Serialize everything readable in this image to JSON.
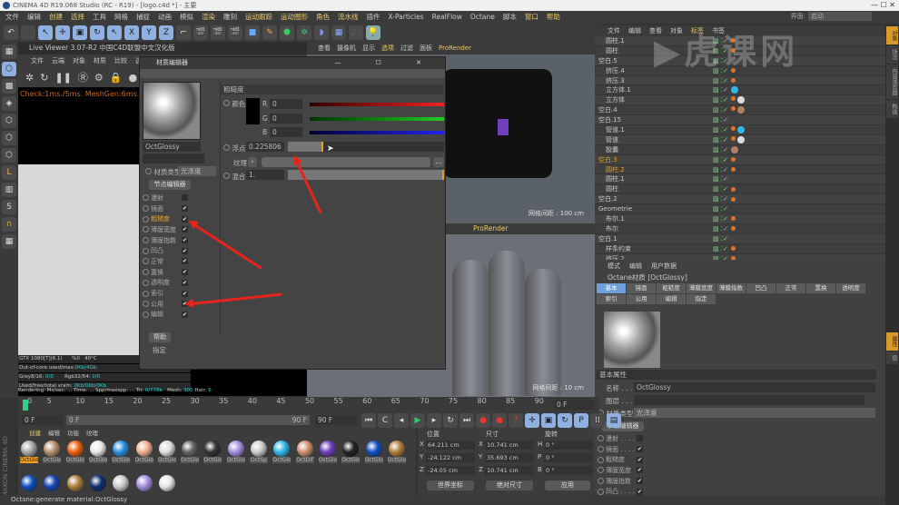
{
  "window": {
    "title": "CINEMA 4D R19.068 Studio (RC - R19) - [logo.c4d *] - 主要",
    "controls": "— ☐ ✕"
  },
  "menubar": {
    "items": [
      "文件",
      "编辑",
      "创建",
      "选择",
      "工具",
      "网格",
      "捕捉",
      "动画",
      "模拟",
      "渲染",
      "雕刻",
      "运动跟踪",
      "运动图形",
      "角色",
      "流水线",
      "插件",
      "X-Particles",
      "RealFlow",
      "Octane",
      "脚本",
      "窗口",
      "帮助"
    ],
    "layout_label": "界面:",
    "layout_value": "启动"
  },
  "live_viewer": {
    "title": "Live Viewer 3.07-R2 中国C4D联盟中文汉化版",
    "menu": [
      "文件",
      "云端",
      "对象",
      "材质",
      "比较",
      "选项"
    ],
    "status": "Check:1ms./5ms. MeshGen:6ms. Update",
    "stats": {
      "gpu": "GTX 1080[T](6.1)",
      "gpu_pct": "%0",
      "gpu_temp": "40°C",
      "ooc_label": "Out-of-core used/max:",
      "ooc_val": "0Kb/4Gb",
      "grey_label": "Grey8/16:",
      "grey_val": "0/0",
      "rgb_label": "Rgb32/64:",
      "rgb_val": "0/0",
      "vram_label": "Used/free/total vram:",
      "vram_val": "0Kb/0Kb/0Kb",
      "rendering": "Rendering:   Ms/sec: ...  Time: ...   Spp/maxspp: ...  Tri:",
      "tri": "0/778k",
      "mesh_label": "Mesh:",
      "mesh": "300",
      "hair_label": "Hair:",
      "hair": "6"
    }
  },
  "viewport_top": {
    "menu": [
      "查看",
      "摄像机",
      "显示",
      "选项",
      "过滤",
      "面板",
      "ProRender"
    ],
    "grid": "网格间距 : 100 cm"
  },
  "viewport_bottom": {
    "title": "ProRender",
    "grid": "网格间距 : 10 cm"
  },
  "material_editor": {
    "title": "材质编辑器",
    "name": "OctGlossy",
    "section": "粗糙度",
    "color_label": "颜色",
    "r": "0",
    "g": "0",
    "b": "0",
    "float_label": "浮点",
    "float_value": "0.225806",
    "float_fraction": 0.225806,
    "texture_label": "纹理",
    "mix_label": "混合",
    "mix_value": "1.",
    "type_label": "材质类型",
    "type_value": "光泽度",
    "node_editor": "节点编辑器",
    "channels": [
      {
        "label": "漫射",
        "on": false
      },
      {
        "label": "镜面",
        "on": true
      },
      {
        "label": "粗糙度",
        "on": true,
        "active": true
      },
      {
        "label": "薄膜宽度",
        "on": true
      },
      {
        "label": "薄膜指数",
        "on": true
      },
      {
        "label": "凹凸",
        "on": true
      },
      {
        "label": "正常",
        "on": true
      },
      {
        "label": "置换",
        "on": true
      },
      {
        "label": "透明度",
        "on": true
      },
      {
        "label": "索引",
        "on": true
      },
      {
        "label": "公用",
        "on": true
      },
      {
        "label": "编辑",
        "on": true
      }
    ],
    "help": "帮助",
    "assign": "指定"
  },
  "object_manager": {
    "menu": [
      "文件",
      "编辑",
      "查看",
      "对象",
      "标签",
      "书签"
    ],
    "objects": [
      {
        "name": "圆柱.1"
      },
      {
        "name": "圆柱"
      },
      {
        "name": "空白.5"
      },
      {
        "name": "挤压.4"
      },
      {
        "name": "挤压.3"
      },
      {
        "name": "立方体.1"
      },
      {
        "name": "立方体"
      },
      {
        "name": "空白.4"
      },
      {
        "name": "空白.15"
      },
      {
        "name": "管道.1"
      },
      {
        "name": "管道"
      },
      {
        "name": "胶囊"
      },
      {
        "name": "空白.3",
        "sel": true
      },
      {
        "name": "圆柱.2",
        "sel": true
      },
      {
        "name": "圆柱.1"
      },
      {
        "name": "圆柱"
      },
      {
        "name": "空白.2"
      },
      {
        "name": "Geometrie"
      },
      {
        "name": "布尔.1"
      },
      {
        "name": "布尔"
      },
      {
        "name": "空白.1"
      },
      {
        "name": "样条约束"
      },
      {
        "name": "挤压.2"
      }
    ]
  },
  "right_tabs": [
    "对象",
    "场次",
    "内容浏览器",
    "构造",
    "属性",
    "层"
  ],
  "attribute_manager": {
    "menu": [
      "模式",
      "编辑",
      "用户数据"
    ],
    "title": "Octane材质 [OctGlossy]",
    "tabs": [
      "基本",
      "镜面",
      "粗糙度",
      "薄膜宽度",
      "薄膜指数",
      "凹凸",
      "正常",
      "置换",
      "透明度",
      "索引",
      "公用",
      "编辑",
      "指定"
    ],
    "section": "基本属性",
    "name_label": "名称 . . . .",
    "name_value": "OctGlossy",
    "layer_label": "图层 . . . .",
    "type_label": "材质类型",
    "type_value": "光泽度",
    "node_editor": "节点编辑器",
    "channels": [
      {
        "label": "漫射 . . . .",
        "on": false
      },
      {
        "label": "镜面 . . . .",
        "on": true
      },
      {
        "label": "粗糙度",
        "on": true
      },
      {
        "label": "薄膜宽度",
        "on": true
      },
      {
        "label": "薄膜指数",
        "on": true
      },
      {
        "label": "凹凸 . . . .",
        "on": true
      }
    ]
  },
  "timeline": {
    "ticks": [
      "0",
      "5",
      "10",
      "15",
      "20",
      "25",
      "30",
      "35",
      "40",
      "45",
      "50",
      "55",
      "60",
      "65",
      "70",
      "75",
      "80",
      "85",
      "90"
    ],
    "current": "0 F"
  },
  "frames": {
    "start": "0 F",
    "range_start": "0 F",
    "range_end": "90 F",
    "end": "90 F"
  },
  "material_manager": {
    "menu": [
      "创建",
      "编辑",
      "功能",
      "纹理"
    ],
    "materials": [
      {
        "name": "OctGlo",
        "color": "#aaa",
        "active": true
      },
      {
        "name": "OctGlo",
        "color": "#b89070"
      },
      {
        "name": "OctGlo",
        "color": "#ee6010"
      },
      {
        "name": "OctGlo",
        "color": "#e8e8e8"
      },
      {
        "name": "OctGlo",
        "color": "#2a90e0"
      },
      {
        "name": "OctGlo",
        "color": "#f0b090"
      },
      {
        "name": "OctGlo",
        "color": "#ddd"
      },
      {
        "name": "OctGlo",
        "color": "#666"
      },
      {
        "name": "OctGlo",
        "color": "#333"
      },
      {
        "name": "OctGlo",
        "color": "#a890e0"
      },
      {
        "name": "OctSp",
        "color": "#ccc"
      },
      {
        "name": "OctGlo",
        "color": "#30b8e8"
      },
      {
        "name": "OctDif",
        "color": "#d09070"
      },
      {
        "name": "OctGlo",
        "color": "#7040c0"
      },
      {
        "name": "OctGlo",
        "color": "#222"
      },
      {
        "name": "OctGlo",
        "color": "#1050c0"
      },
      {
        "name": "OctGlo",
        "color": "#b08040"
      },
      {
        "name": "",
        "color": "#1050c0"
      },
      {
        "name": "",
        "color": "#1848b0"
      },
      {
        "name": "",
        "color": "#b08040"
      },
      {
        "name": "",
        "color": "#103070"
      },
      {
        "name": "",
        "color": "#ccc"
      },
      {
        "name": "",
        "color": "#a890e0"
      },
      {
        "name": "",
        "color": "#e8e8e8"
      }
    ]
  },
  "coordinates": {
    "headers": [
      "位置",
      "尺寸",
      "旋转"
    ],
    "rows": [
      {
        "axis": "X",
        "pos": "64.211 cm",
        "saxis": "X",
        "size": "10.741 cm",
        "raxis": "H",
        "rot": "0 °"
      },
      {
        "axis": "Y",
        "pos": "-24.122 cm",
        "saxis": "Y",
        "size": "35.693 cm",
        "raxis": "P",
        "rot": "0 °"
      },
      {
        "axis": "Z",
        "pos": "-24.05 cm",
        "saxis": "Z",
        "size": "10.741 cm",
        "raxis": "B",
        "rot": "0 °"
      }
    ],
    "space": "世界坐标",
    "mode": "绝对尺寸",
    "apply": "应用"
  },
  "status": "Octane:generate material:OctGlossy",
  "branding": "MAXON CINEMA 4D",
  "watermark": "虎课网",
  "colors": {
    "accent": "#e8a020",
    "arrow": "#e8231e"
  }
}
